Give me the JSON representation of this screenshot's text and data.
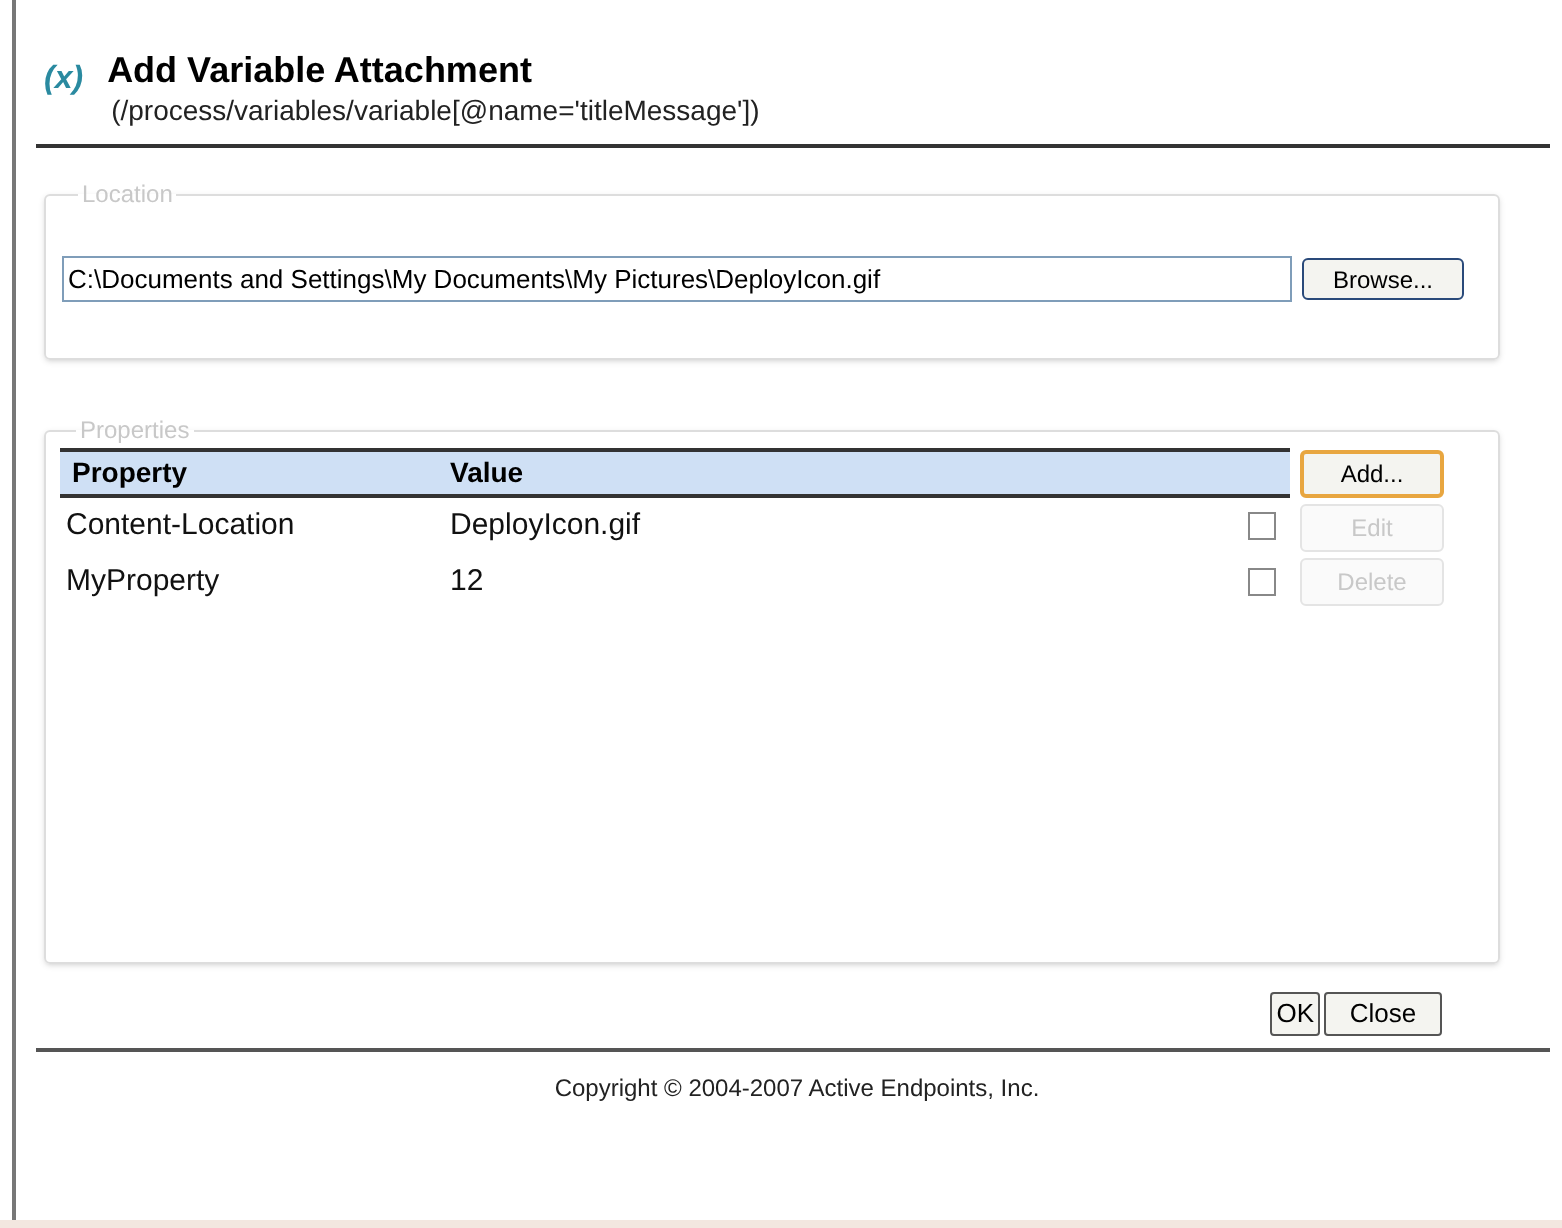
{
  "header": {
    "icon_text": "(x)",
    "title": "Add Variable Attachment",
    "subtitle": "(/process/variables/variable[@name='titleMessage'])"
  },
  "location": {
    "legend": "Location",
    "file_value": "C:\\Documents and Settings\\My Documents\\My Pictures\\DeployIcon.gif",
    "browse_button": "Browse..."
  },
  "properties": {
    "legend": "Properties",
    "columns": [
      "Property",
      "Value"
    ],
    "rows": [
      {
        "cells": [
          "Content-Location",
          "DeployIcon.gif"
        ],
        "checked": false
      },
      {
        "cells": [
          "MyProperty",
          "12"
        ],
        "checked": false
      }
    ],
    "buttons": [
      {
        "label": "Add...",
        "disabled": false,
        "focused": true
      },
      {
        "label": "Edit",
        "disabled": true,
        "focused": false
      },
      {
        "label": "Delete",
        "disabled": true,
        "focused": false
      }
    ]
  },
  "dialog_buttons": [
    "OK",
    "Close"
  ],
  "footer": "Copyright © 2004-2007 Active Endpoints, Inc."
}
